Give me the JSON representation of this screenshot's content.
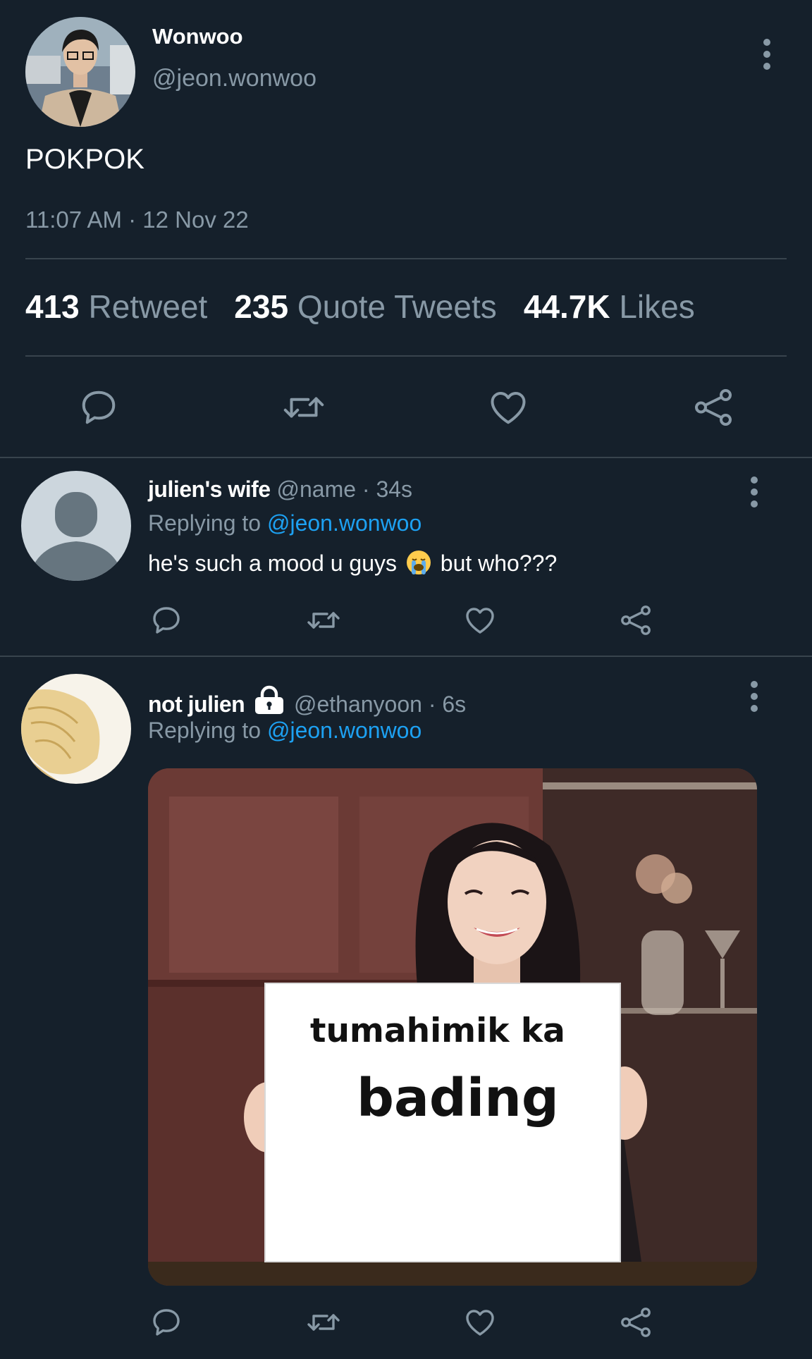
{
  "main_tweet": {
    "display_name": "Wonwoo",
    "handle": "@jeon.wonwoo",
    "text": "POKPOK",
    "timestamp": "11:07 AM · 12 Nov 22",
    "stats": {
      "retweets_count": "413",
      "retweets_label": "Retweet",
      "quotes_count": "235",
      "quotes_label": "Quote Tweets",
      "likes_count": "44.7K",
      "likes_label": "Likes"
    },
    "actions": [
      "reply-icon",
      "retweet-icon",
      "like-icon",
      "share-icon"
    ]
  },
  "replies": [
    {
      "display_name": "julien's wife",
      "handle": "@name",
      "time": "· 34s",
      "replying_prefix": "Replying to",
      "replying_to": "@jeon.wonwoo",
      "text_before_emoji": "he's such a mood u guys",
      "emoji": "loudly-crying-face",
      "text_after_emoji": "but who???"
    },
    {
      "display_name": "not julien",
      "locked_icon": "lock-icon",
      "handle": "@ethanyoon",
      "time": "· 6s",
      "replying_prefix": "Replying to",
      "replying_to": "@jeon.wonwoo",
      "image": {
        "sign_line1": "tumahimik ka",
        "sign_line2": "bading"
      }
    }
  ],
  "colors": {
    "background": "#15202b",
    "divider": "#38444d",
    "secondary_text": "#8899a6",
    "link": "#1da1f2"
  }
}
